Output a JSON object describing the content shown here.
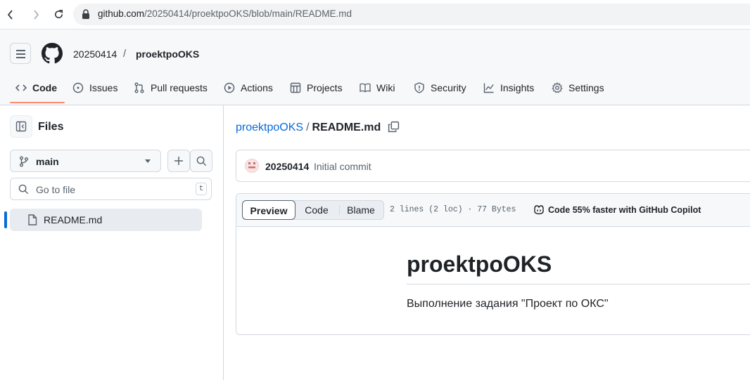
{
  "browser": {
    "url_host": "github.com",
    "url_path": "/20250414/proektpoOKS/blob/main/README.md"
  },
  "repo": {
    "owner": "20250414",
    "separator": "/",
    "name": "proektpoOKS"
  },
  "tabs": [
    {
      "label": "Code",
      "icon": "code-icon",
      "active": true
    },
    {
      "label": "Issues",
      "icon": "issue-icon"
    },
    {
      "label": "Pull requests",
      "icon": "pull-request-icon"
    },
    {
      "label": "Actions",
      "icon": "play-icon"
    },
    {
      "label": "Projects",
      "icon": "table-icon"
    },
    {
      "label": "Wiki",
      "icon": "book-icon"
    },
    {
      "label": "Security",
      "icon": "shield-icon"
    },
    {
      "label": "Insights",
      "icon": "graph-icon"
    },
    {
      "label": "Settings",
      "icon": "gear-icon"
    }
  ],
  "sidebar": {
    "title": "Files",
    "branch": "main",
    "goto_placeholder": "Go to file",
    "goto_shortcut": "t",
    "files": [
      {
        "name": "README.md",
        "selected": true
      }
    ]
  },
  "main": {
    "path_repo": "proektpoOKS",
    "path_sep": "/",
    "path_file": "README.md",
    "commit": {
      "author": "20250414",
      "message": "Initial commit"
    },
    "view_modes": [
      "Preview",
      "Code",
      "Blame"
    ],
    "active_view": "Preview",
    "file_meta": "2 lines (2 loc) · 77 Bytes",
    "copilot_label": "Code 55% faster with GitHub Copilot",
    "readme": {
      "heading": "proektpoOKS",
      "paragraph": "Выполнение задания \"Проект по ОКС\""
    }
  },
  "colors": {
    "link": "#0969da",
    "tab_underline": "#fd8c73",
    "border": "#d1d9e0"
  }
}
